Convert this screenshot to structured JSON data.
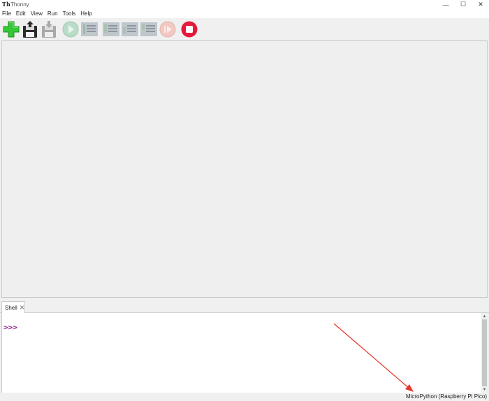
{
  "window": {
    "logo": "Th",
    "title": "Thonny",
    "minimize": "—",
    "maximize": "☐",
    "close": "✕"
  },
  "menu": [
    "File",
    "Edit",
    "View",
    "Run",
    "Tools",
    "Help"
  ],
  "toolbar": {
    "buttons": [
      {
        "name": "new-file-button",
        "icon": "green-plus-icon",
        "enabled": true
      },
      {
        "name": "open-file-button",
        "icon": "floppy-open-icon",
        "enabled": true
      },
      {
        "name": "save-file-button",
        "icon": "floppy-save-icon",
        "enabled": false
      },
      {
        "name": "run-button",
        "icon": "play-icon",
        "enabled": false
      },
      {
        "name": "debug-button",
        "icon": "debug-lines-icon",
        "enabled": false
      },
      {
        "name": "step-over-button",
        "icon": "step-over-icon",
        "enabled": false
      },
      {
        "name": "step-into-button",
        "icon": "step-into-icon",
        "enabled": false
      },
      {
        "name": "step-out-button",
        "icon": "step-out-icon",
        "enabled": false
      },
      {
        "name": "resume-button",
        "icon": "resume-icon",
        "enabled": false
      },
      {
        "name": "stop-button",
        "icon": "stop-icon",
        "enabled": true
      }
    ]
  },
  "shell": {
    "tab_label": "Shell",
    "tab_close": "✕",
    "prompt": ">>>"
  },
  "scrollbar": {
    "up": "▲",
    "down": "▼"
  },
  "status": {
    "interpreter": "MicroPython (Raspberry Pi Pico)"
  },
  "colors": {
    "prompt": "#8b1f8b",
    "stop": "#e5193b",
    "new_file": "#2ec52e",
    "annotation_arrow": "#e8342a"
  }
}
